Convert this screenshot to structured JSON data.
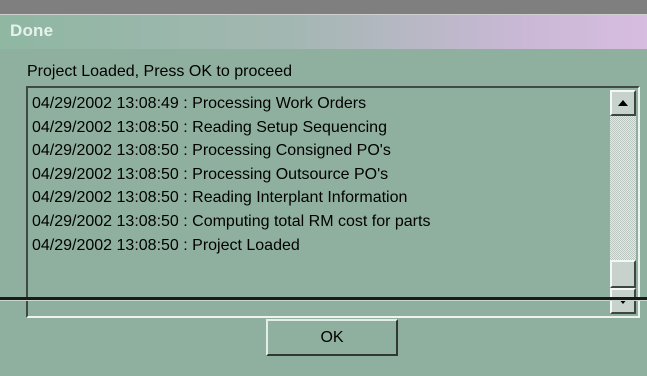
{
  "window": {
    "title": "Done"
  },
  "dialog": {
    "prompt": "Project Loaded, Press OK to proceed",
    "log_entries": [
      "04/29/2002 13:08:49 : Processing Work Orders",
      "04/29/2002 13:08:50 : Reading Setup Sequencing",
      "04/29/2002 13:08:50 : Processing Consigned PO's",
      "04/29/2002 13:08:50 : Processing Outsource PO's",
      "04/29/2002 13:08:50 : Reading Interplant Information",
      "04/29/2002 13:08:50 : Computing total RM cost for parts",
      "04/29/2002 13:08:50 : Project Loaded"
    ],
    "scrollbar": {
      "up_icon": "arrow-up-icon",
      "down_icon": "arrow-down-icon"
    },
    "ok_label": "OK"
  },
  "colors": {
    "background": "#8fb09f",
    "title_gradient_start": "#8fb7a2",
    "title_gradient_end": "#d7bde0",
    "title_text": "#e6f2ec"
  }
}
